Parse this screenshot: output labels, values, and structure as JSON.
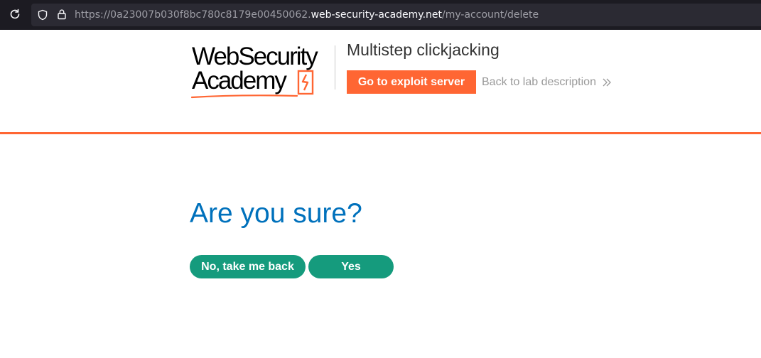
{
  "browser": {
    "url_prefix": "https://0a23007b030f8bc780c8179e00450062.",
    "url_domain": "web-security-academy.net",
    "url_path": "/my-account/delete",
    "icons": [
      "reload-icon",
      "shield-icon",
      "lock-icon"
    ]
  },
  "header": {
    "logo_line1": "WebSecurity",
    "logo_line2": "Academy",
    "lab_title": "Multistep clickjacking",
    "exploit_button_label": "Go to exploit server",
    "back_link_label": "Back to lab description",
    "accent_color": "#ff6633"
  },
  "main": {
    "heading": "Are you sure?",
    "no_button_label": "No, take me back",
    "yes_button_label": "Yes",
    "heading_color": "#0071bc",
    "button_color": "#159b7d"
  }
}
